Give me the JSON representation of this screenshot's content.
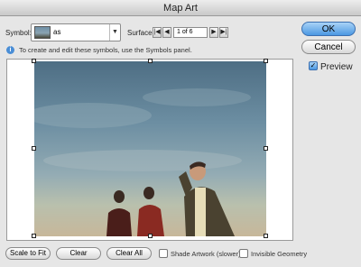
{
  "window": {
    "title": "Map Art"
  },
  "symbol": {
    "label": "Symbol:",
    "value": "as"
  },
  "surface": {
    "label": "Surface:",
    "value": "1  of 6",
    "first": "|◀",
    "prev": "◀",
    "next": "▶",
    "last": "▶|"
  },
  "info": {
    "text": "To create and edit these symbols, use the Symbols panel."
  },
  "buttons": {
    "ok": "OK",
    "cancel": "Cancel"
  },
  "preview": {
    "label": "Preview",
    "checked": true
  },
  "bottom": {
    "scale_to_fit": "Scale to Fit",
    "clear": "Clear",
    "clear_all": "Clear All",
    "shade_artwork": "Shade Artwork (slower)",
    "invisible_geometry": "Invisible Geometry"
  },
  "colors": {
    "accent": "#4b98e2",
    "sky": "#6c8ea2"
  }
}
